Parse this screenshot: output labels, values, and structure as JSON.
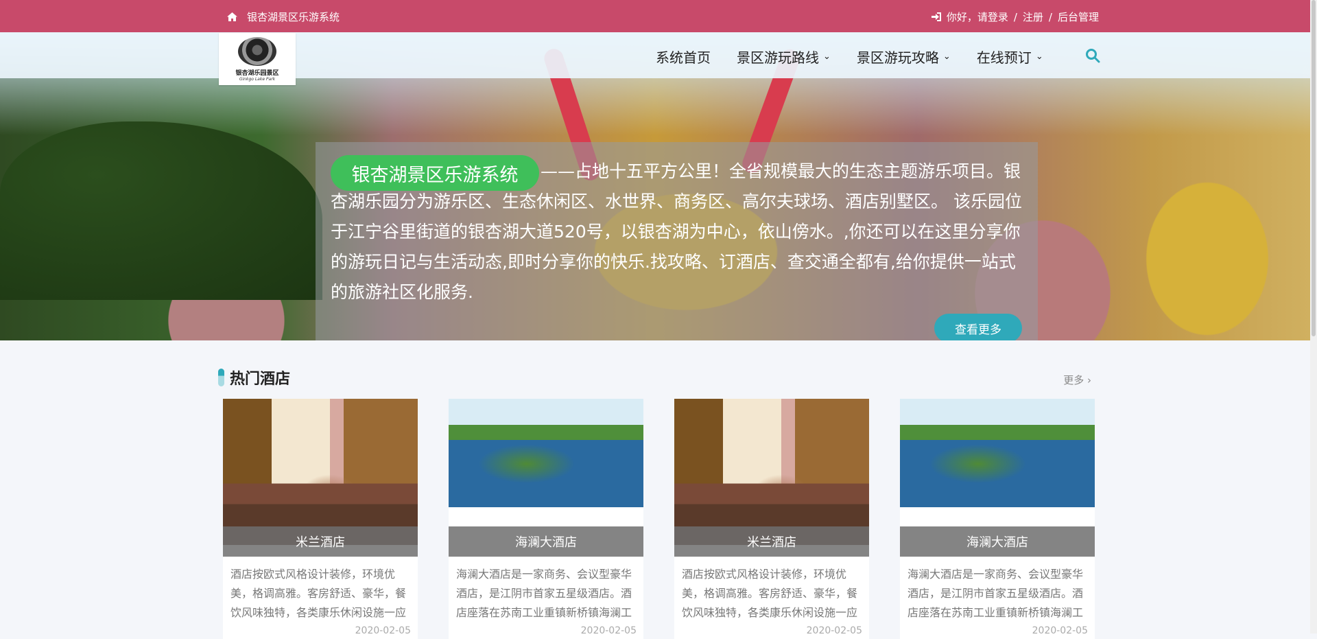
{
  "topbar": {
    "home_icon": "home-icon",
    "site_name": "银杏湖景区乐游系统",
    "login_icon": "sign-in-icon",
    "login": "你好，请登录",
    "sep1": "/",
    "register": "注册",
    "sep2": "/",
    "admin": "后台管理",
    "bg_color": "#c84a6a"
  },
  "logo": {
    "title": "银杏湖乐园景区",
    "subtitle": "Ginkgo Lake Park"
  },
  "nav": {
    "items": [
      {
        "label": "系统首页"
      },
      {
        "label": "景区游玩路线"
      },
      {
        "label": "景区游玩攻略"
      },
      {
        "label": "在线预订"
      }
    ],
    "search_icon": "search-icon"
  },
  "hero": {
    "badge": "银杏湖景区乐游系统",
    "description": "——占地十五平方公里！全省规模最大的生态主题游乐项目。银杏湖乐园分为游乐区、生态休闲区、水世界、商务区、高尔夫球场、酒店别墅区。 该乐园位于江宁谷里街道的银杏湖大道520号，以银杏湖为中心，依山傍水。,你还可以在这里分享你的游玩日记与生活动态,即时分享你的快乐.找攻略、订酒店、查交通全都有,给你提供一站式的旅游社区化服务.",
    "more_button": "查看更多",
    "accent": "#2fa9ba",
    "badge_color": "#3fbf5a"
  },
  "hotels": {
    "title": "热门酒店",
    "more": "更多",
    "cards": [
      {
        "name": "米兰酒店",
        "desc": "酒店按欧式风格设计装修，环境优美，格调高雅。客房舒适、豪华，餐饮风味独特，各类康乐休闲设施一应",
        "date": "2020-02-05"
      },
      {
        "name": "海澜大酒店",
        "desc": "海澜大酒店是一家商务、会议型豪华酒店，是江阴市首家五星级酒店。酒店座落在苏南工业重镇新桥镇海澜工",
        "date": "2020-02-05"
      },
      {
        "name": "米兰酒店",
        "desc": "酒店按欧式风格设计装修，环境优美，格调高雅。客房舒适、豪华，餐饮风味独特，各类康乐休闲设施一应",
        "date": "2020-02-05"
      },
      {
        "name": "海澜大酒店",
        "desc": "海澜大酒店是一家商务、会议型豪华酒店，是江阴市首家五星级酒店。酒店座落在苏南工业重镇新桥镇海澜工",
        "date": "2020-02-05"
      }
    ]
  }
}
